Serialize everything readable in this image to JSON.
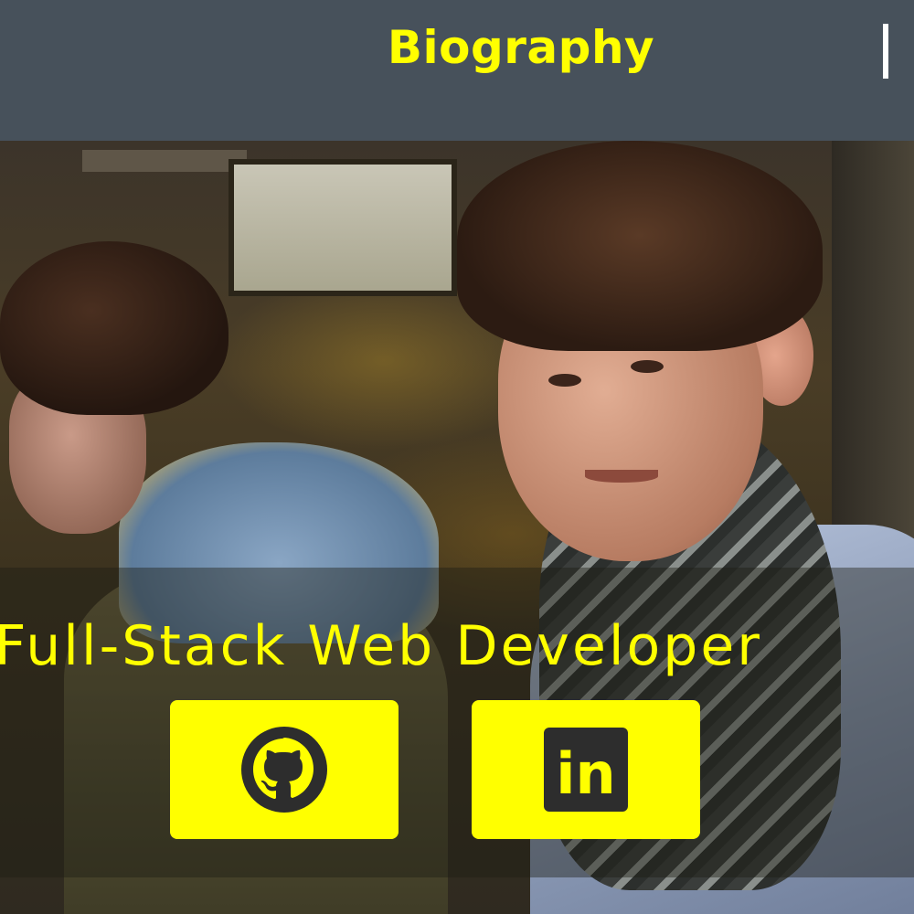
{
  "header": {
    "title": "Biography",
    "menu_icon": "menu-bar-icon"
  },
  "hero": {
    "tagline": "Full-Stack Web Developer"
  },
  "social": [
    {
      "name": "GitHub",
      "icon": "github-icon"
    },
    {
      "name": "LinkedIn",
      "icon": "linkedin-icon",
      "icon_text": "in"
    }
  ],
  "colors": {
    "accent": "#ffff00",
    "header_bg": "#47515b",
    "icon_dark": "#2d2d2d"
  }
}
